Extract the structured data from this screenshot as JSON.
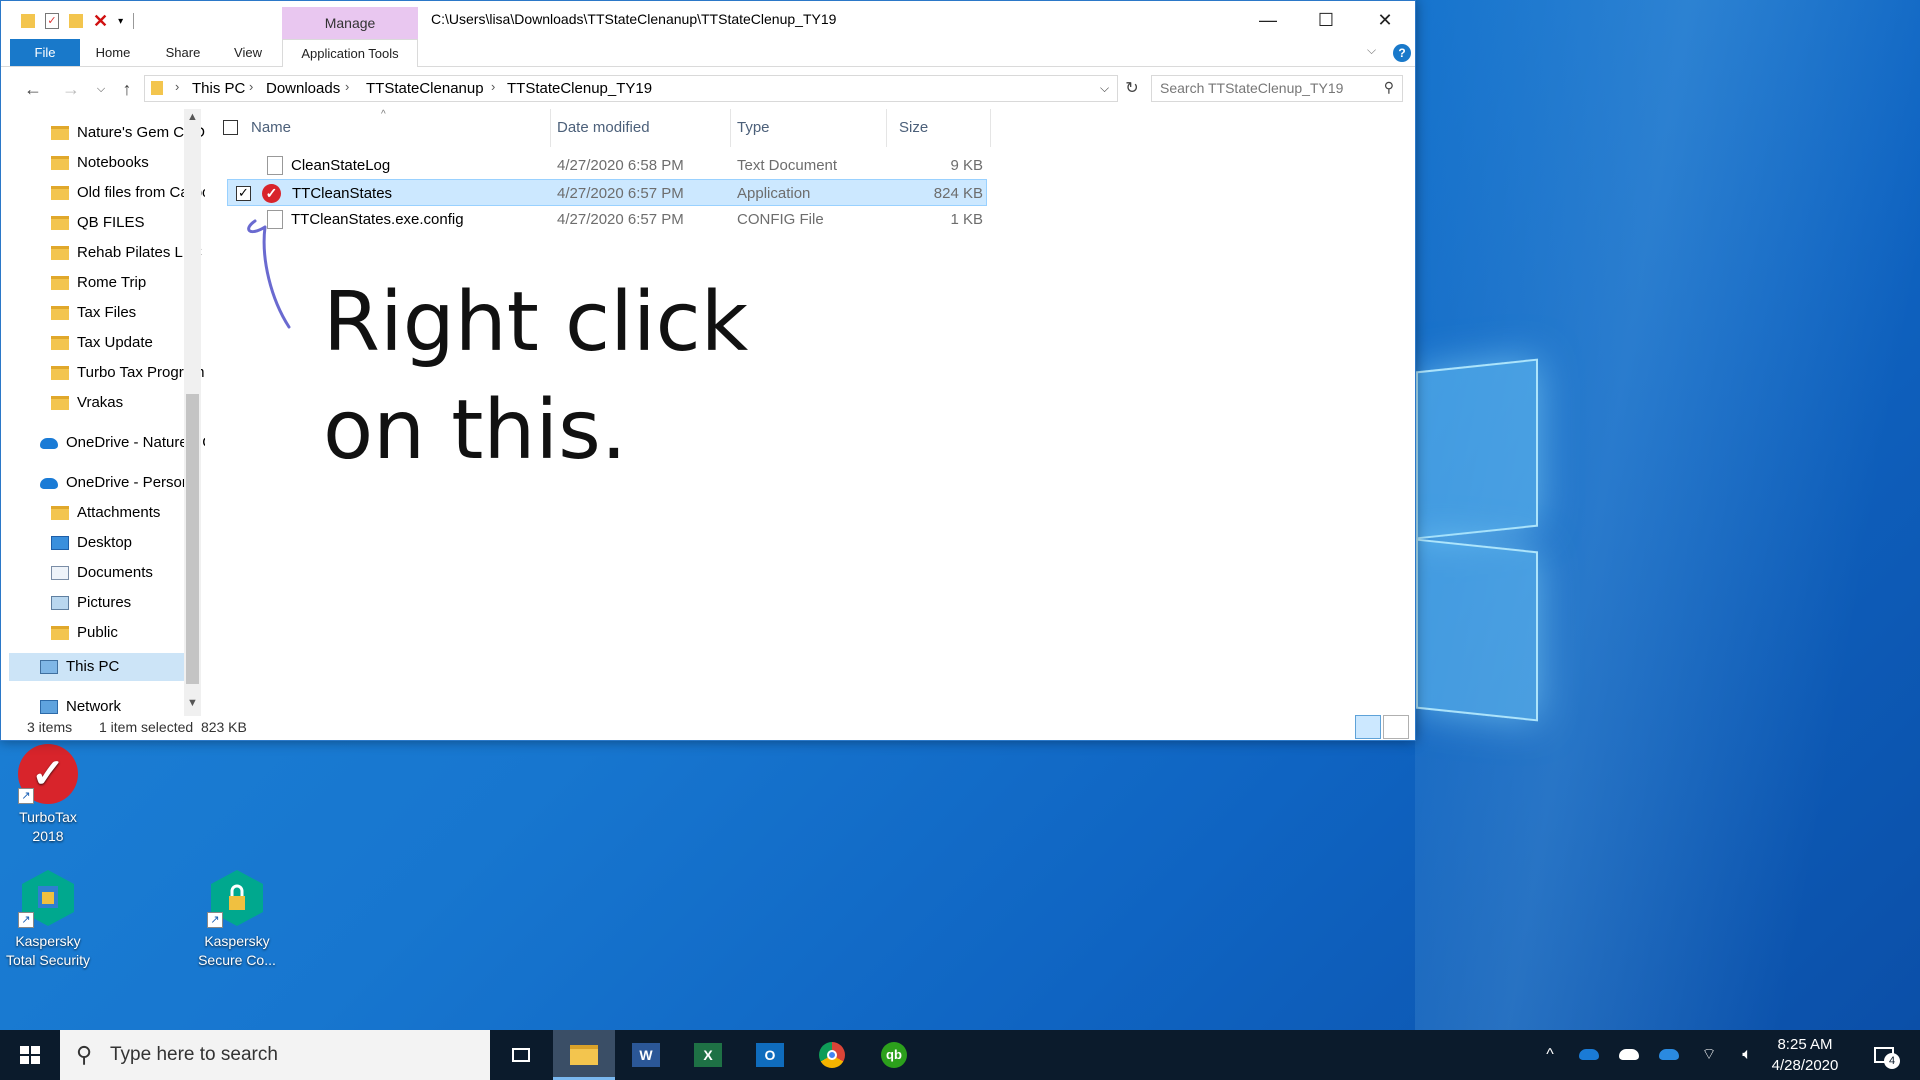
{
  "window": {
    "manage_tab": "Manage",
    "title": "C:\\Users\\lisa\\Downloads\\TTStateClenanup\\TTStateClenup_TY19",
    "minimize_glyph": "—",
    "maximize_glyph": "☐",
    "close_glyph": "✕"
  },
  "ribbon": {
    "tabs": [
      "File",
      "Home",
      "Share",
      "View",
      "Application Tools"
    ]
  },
  "address": {
    "crumbs": [
      "This PC",
      "Downloads",
      "TTStateClenanup",
      "TTStateClenup_TY19"
    ],
    "search_placeholder": "Search TTStateClenup_TY19"
  },
  "navpane": {
    "items": [
      {
        "label": "Nature's Gem CBD",
        "icon": "folder-icon"
      },
      {
        "label": "Notebooks",
        "icon": "folder-icon"
      },
      {
        "label": "Old files from Carbonite",
        "icon": "folder-icon"
      },
      {
        "label": "QB FILES",
        "icon": "folder-icon"
      },
      {
        "label": "Rehab Pilates LLC",
        "icon": "folder-icon"
      },
      {
        "label": "Rome Trip",
        "icon": "folder-icon"
      },
      {
        "label": "Tax Files",
        "icon": "folder-icon"
      },
      {
        "label": "Tax Update",
        "icon": "folder-icon"
      },
      {
        "label": "Turbo Tax Programs",
        "icon": "folder-icon"
      },
      {
        "label": "Vrakas",
        "icon": "folder-icon"
      },
      {
        "label": "OneDrive - Nature's Gem",
        "icon": "onedrive-icon"
      },
      {
        "label": "OneDrive - Personal",
        "icon": "onedrive-icon"
      },
      {
        "label": "Attachments",
        "icon": "folder-icon"
      },
      {
        "label": "Desktop",
        "icon": "desktop-icon"
      },
      {
        "label": "Documents",
        "icon": "documents-icon"
      },
      {
        "label": "Pictures",
        "icon": "pictures-icon"
      },
      {
        "label": "Public",
        "icon": "folder-icon"
      },
      {
        "label": "This PC",
        "icon": "computer-icon"
      },
      {
        "label": "Network",
        "icon": "network-icon"
      }
    ]
  },
  "columns": {
    "name": "Name",
    "date": "Date modified",
    "type": "Type",
    "size": "Size"
  },
  "files": [
    {
      "name": "CleanStateLog",
      "date": "4/27/2020 6:58 PM",
      "type": "Text Document",
      "size": "9 KB",
      "icon": "text-file-icon"
    },
    {
      "name": "TTCleanStates",
      "date": "4/27/2020 6:57 PM",
      "type": "Application",
      "size": "824 KB",
      "icon": "turbotax-app-icon"
    },
    {
      "name": "TTCleanStates.exe.config",
      "date": "4/27/2020 6:57 PM",
      "type": "CONFIG File",
      "size": "1 KB",
      "icon": "config-file-icon"
    }
  ],
  "annotation": {
    "line1": "Right click",
    "line2": "on this."
  },
  "status": {
    "count": "3 items",
    "selection": "1 item selected  823 KB"
  },
  "desktop_icons": [
    {
      "line1": "TurboTax",
      "line2": "2018"
    },
    {
      "line1": "Kaspersky",
      "line2": "Total Security"
    },
    {
      "line1": "Kaspersky",
      "line2": "Secure Co..."
    }
  ],
  "taskbar": {
    "search_placeholder": "Type here to search",
    "time": "8:25 AM",
    "date": "4/28/2020",
    "notification_count": "4"
  },
  "colors": {
    "accent": "#1979ca",
    "selection": "#cce8ff",
    "manage_tab": "#e9c7f0",
    "annotation_pen": "#6a6ad0"
  }
}
